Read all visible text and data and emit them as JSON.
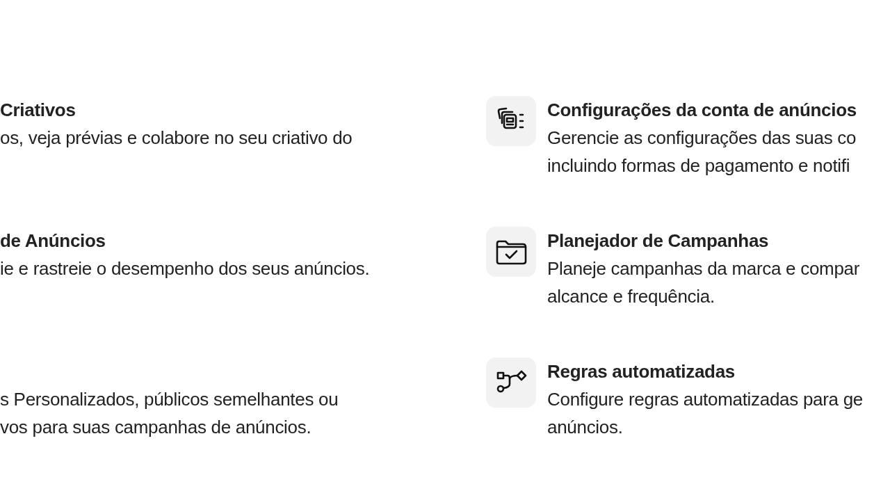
{
  "left_items": [
    {
      "title": "Criativos",
      "lines": [
        "os, veja prévias e colabore no seu criativo do"
      ]
    },
    {
      "title": "de Anúncios",
      "lines": [
        "ie e rastreie o desempenho dos seus anúncios."
      ]
    },
    {
      "lines": [
        "s Personalizados, públicos semelhantes ou",
        "vos para suas campanhas de anúncios."
      ]
    }
  ],
  "right_items": [
    {
      "kind": "settings",
      "title": "Configurações da conta de anúncios",
      "lines": [
        "Gerencie as configurações das suas co",
        "incluindo formas de pagamento e notifi"
      ]
    },
    {
      "kind": "planner",
      "title": "Planejador de Campanhas",
      "lines": [
        "Planeje campanhas da marca e compar",
        "alcance e frequência."
      ]
    },
    {
      "kind": "rules",
      "title": "Regras automatizadas",
      "lines": [
        "Configure regras automatizadas para ge",
        "anúncios."
      ]
    }
  ]
}
